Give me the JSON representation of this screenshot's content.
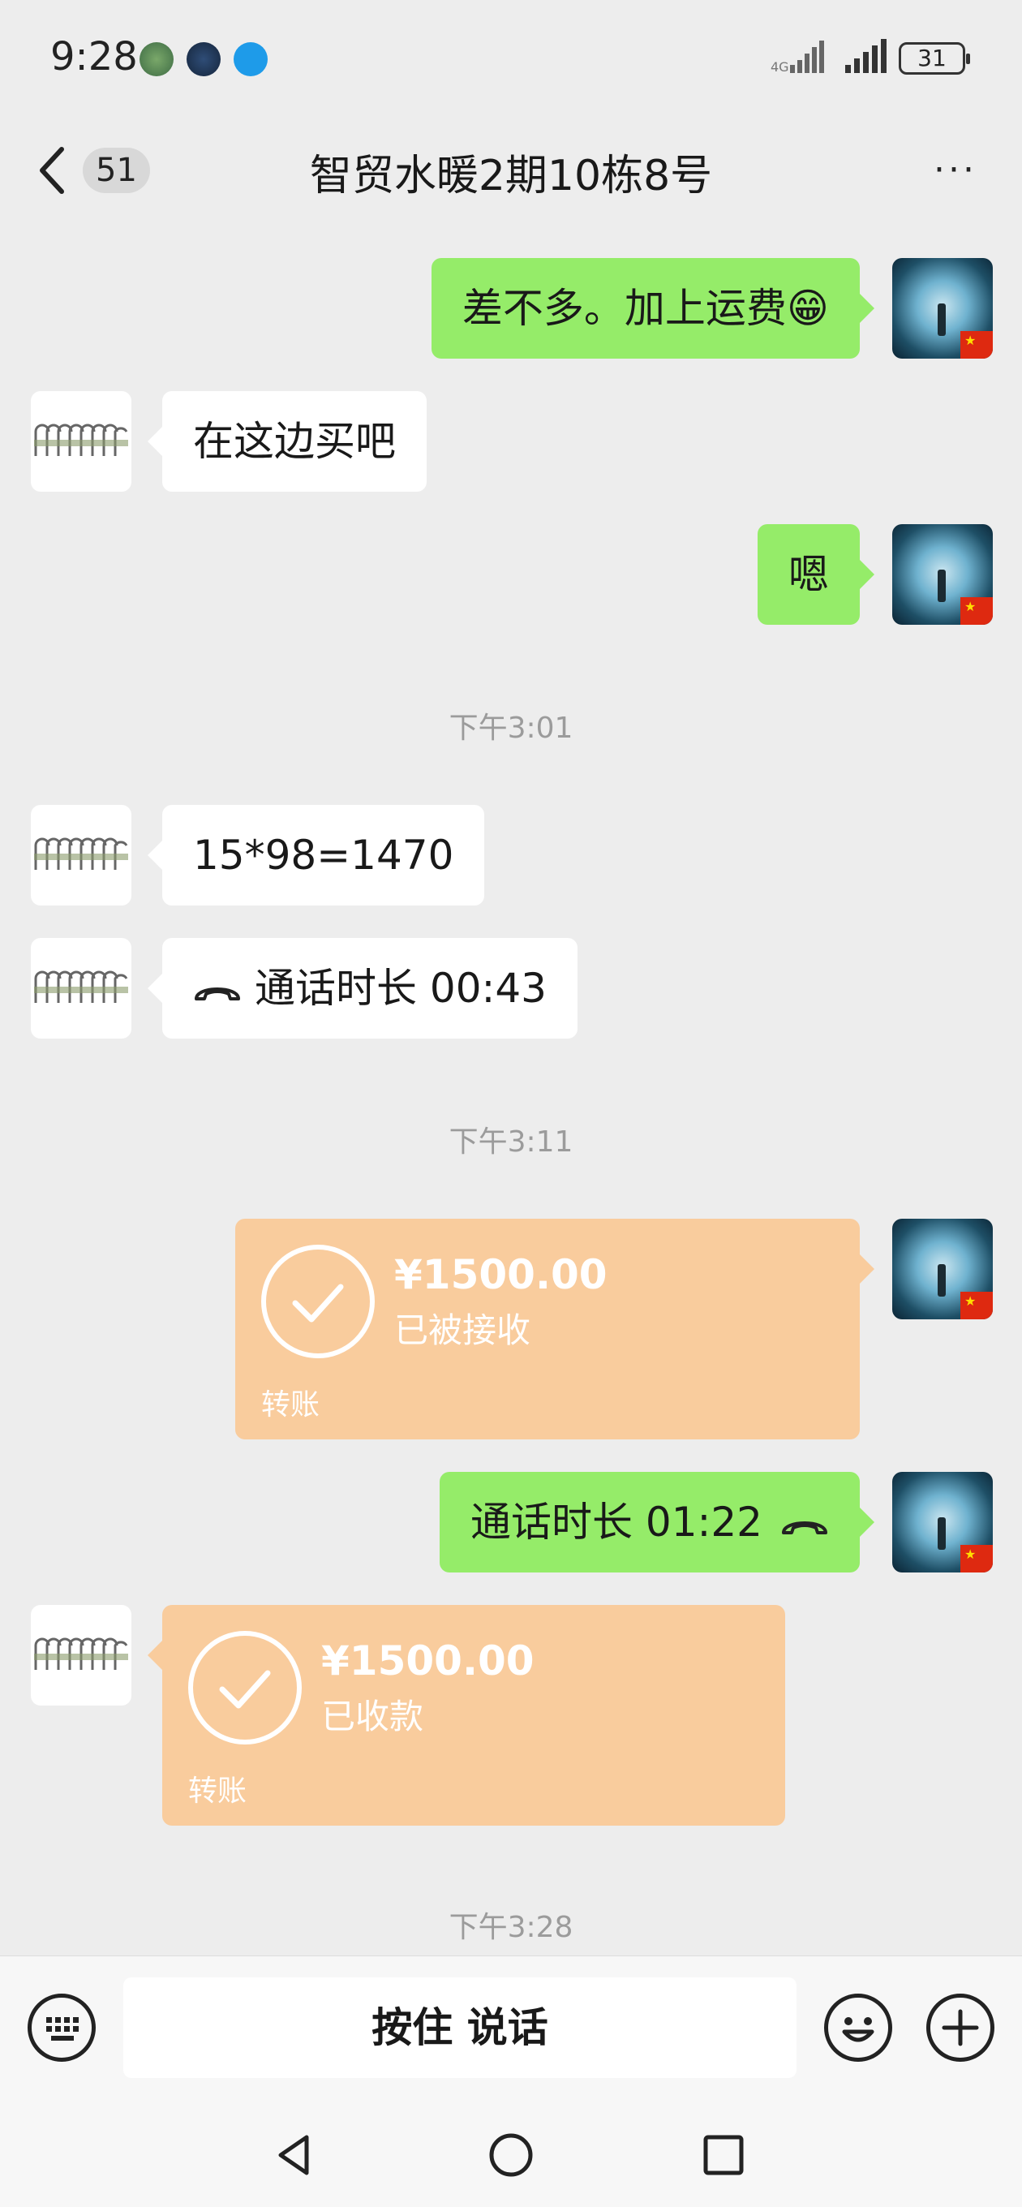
{
  "status_bar": {
    "time": "9:28",
    "battery": "31"
  },
  "header": {
    "back_badge": "51",
    "title": "智贸水暖2期10栋8号",
    "more": "···"
  },
  "messages": {
    "m1": "差不多。加上运费😁",
    "m2": "在这边买吧",
    "m3": "嗯",
    "t1": "下午3:01",
    "m4": "15*98=1470",
    "m5": "通话时长 00:43",
    "t2": "下午3:11",
    "transfer1": {
      "amount": "¥1500.00",
      "status": "已被接收",
      "label": "转账"
    },
    "m6": "通话时长 01:22",
    "transfer2": {
      "amount": "¥1500.00",
      "status": "已收款",
      "label": "转账"
    },
    "t3": "下午3:28"
  },
  "input_bar": {
    "voice_label": "按住 说话"
  },
  "icons": {
    "keyboard": "keyboard-icon",
    "emoji": "emoji-icon",
    "plus": "plus-icon",
    "back": "chevron-left-icon",
    "call": "phone-call-icon",
    "check": "check-icon"
  },
  "colors": {
    "self_bubble": "#95ec69",
    "other_bubble": "#ffffff",
    "transfer": "#f9cc9d",
    "background": "#ededed"
  }
}
